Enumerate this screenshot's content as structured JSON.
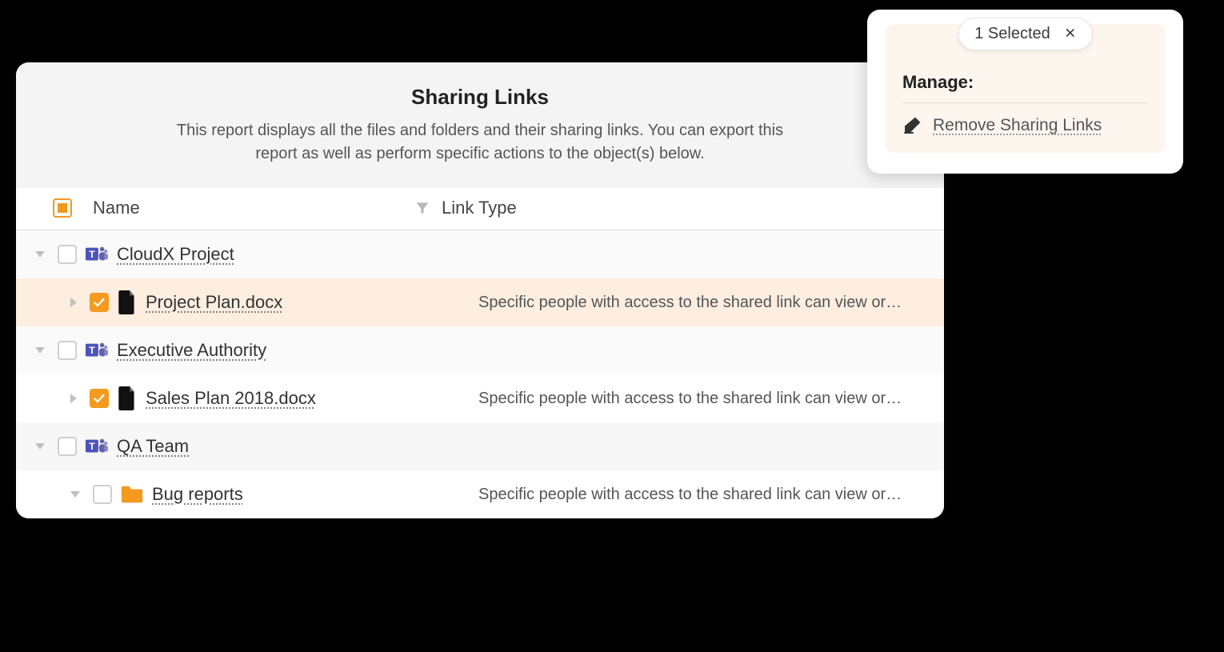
{
  "report": {
    "title": "Sharing Links",
    "description": "This report displays all the files and folders and their sharing links. You can export this report as well as perform specific actions to the object(s) below."
  },
  "columns": {
    "name": "Name",
    "link_type": "Link Type"
  },
  "rows": [
    {
      "kind": "group",
      "name": "CloudX Project",
      "icon": "teams",
      "checked": false,
      "expanded": true,
      "link_type": ""
    },
    {
      "kind": "item",
      "name": "Project Plan.docx",
      "icon": "doc",
      "checked": true,
      "expanded": false,
      "selected": true,
      "link_type": "Specific people with access to the shared link can view or…"
    },
    {
      "kind": "group",
      "name": "Executive Authority",
      "icon": "teams",
      "checked": false,
      "expanded": true,
      "link_type": ""
    },
    {
      "kind": "item",
      "name": "Sales Plan 2018.docx",
      "icon": "doc",
      "checked": true,
      "expanded": false,
      "link_type": "Specific people with access to the shared link can view or…"
    },
    {
      "kind": "group",
      "name": "QA Team",
      "icon": "teams",
      "checked": false,
      "expanded": true,
      "link_type": ""
    },
    {
      "kind": "subitem",
      "name": "Bug reports",
      "icon": "folder",
      "checked": false,
      "expanded": true,
      "link_type": "Specific people with access to the shared link can view or…"
    }
  ],
  "manage": {
    "selection_label": "1 Selected",
    "heading": "Manage:",
    "actions": [
      {
        "id": "remove-sharing-links",
        "icon": "eraser",
        "label": "Remove Sharing Links"
      }
    ]
  }
}
